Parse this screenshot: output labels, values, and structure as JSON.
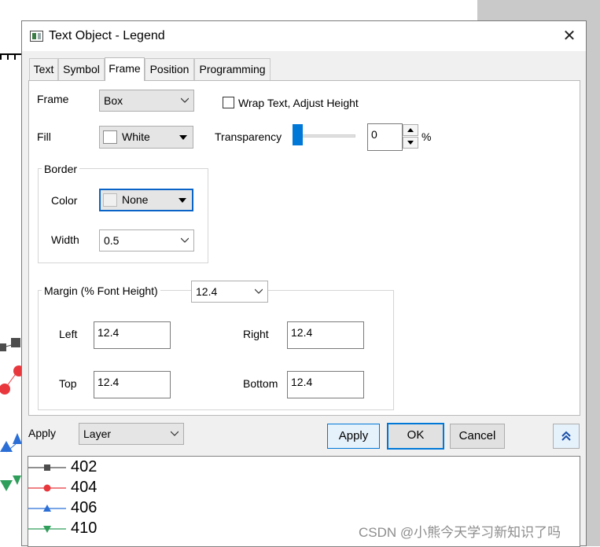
{
  "dialog": {
    "title": "Text Object - Legend",
    "close_glyph": "✕",
    "tabs": [
      {
        "label": "Text",
        "active": false
      },
      {
        "label": "Symbol",
        "active": false
      },
      {
        "label": "Frame",
        "active": true
      },
      {
        "label": "Position",
        "active": false
      },
      {
        "label": "Programming",
        "active": false
      }
    ],
    "frame": {
      "frame_label": "Frame",
      "frame_value": "Box",
      "fill_label": "Fill",
      "fill_value": "White",
      "wrap_label": "Wrap Text, Adjust Height",
      "wrap_checked": false,
      "transparency_label": "Transparency",
      "transparency_value": "0",
      "transparency_level": 0,
      "percent_label": "%"
    },
    "border": {
      "title": "Border",
      "color_label": "Color",
      "color_value": "None",
      "width_label": "Width",
      "width_value": "0.5"
    },
    "margin": {
      "title": "Margin (% Font Height)",
      "value": "12.4",
      "left_label": "Left",
      "left_value": "12.4",
      "right_label": "Right",
      "right_value": "12.4",
      "top_label": "Top",
      "top_value": "12.4",
      "bottom_label": "Bottom",
      "bottom_value": "12.4"
    },
    "footer": {
      "apply_label": "Apply",
      "apply_scope": "Layer",
      "apply_button": "Apply",
      "ok_button": "OK",
      "cancel_button": "Cancel",
      "collapse_icon": "double-chevron-up-icon"
    },
    "legend_preview": [
      {
        "label": "402",
        "color": "#4d4d4d",
        "marker": "square"
      },
      {
        "label": "404",
        "color": "#e8383d",
        "marker": "circle"
      },
      {
        "label": "406",
        "color": "#2b6fd6",
        "marker": "triangle-up"
      },
      {
        "label": "410",
        "color": "#2f9e5b",
        "marker": "triangle-down"
      }
    ]
  },
  "watermark": "CSDN @小熊今天学习新知识了吗"
}
